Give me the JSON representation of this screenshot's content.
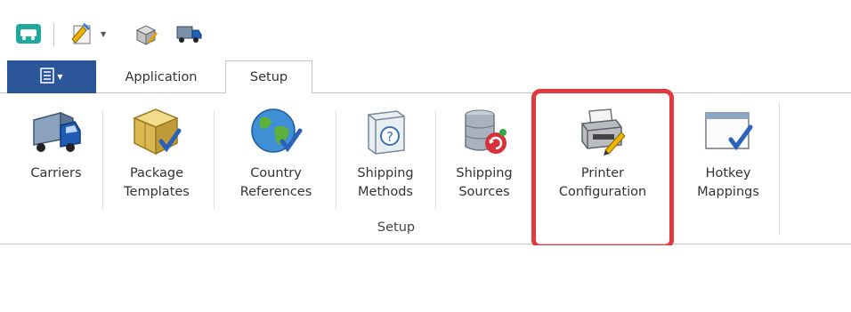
{
  "quick_access": {
    "icons": [
      "app-logo-icon",
      "edit-document-icon",
      "dropdown-arrow-icon",
      "package-edit-icon",
      "truck-icon"
    ]
  },
  "tabs": {
    "file_menu_icon": "list-icon",
    "items": [
      {
        "label": "Application"
      },
      {
        "label": "Setup",
        "active": true
      }
    ]
  },
  "ribbon": {
    "buttons": [
      {
        "label_line1": "Carriers",
        "label_line2": "",
        "icon": "truck-icon"
      },
      {
        "label_line1": "Package",
        "label_line2": "Templates",
        "icon": "package-check-icon"
      },
      {
        "label_line1": "Country",
        "label_line2": "References",
        "icon": "globe-check-icon"
      },
      {
        "label_line1": "Shipping",
        "label_line2": "Methods",
        "icon": "help-box-icon"
      },
      {
        "label_line1": "Shipping",
        "label_line2": "Sources",
        "icon": "database-refresh-icon"
      },
      {
        "label_line1": "Printer",
        "label_line2": "Configuration",
        "icon": "printer-edit-icon"
      },
      {
        "label_line1": "Hotkey",
        "label_line2": "Mappings",
        "icon": "window-check-icon"
      }
    ],
    "group_label": "Setup"
  },
  "colors": {
    "file_tab": "#2b579a",
    "highlight": "#e0393e"
  }
}
